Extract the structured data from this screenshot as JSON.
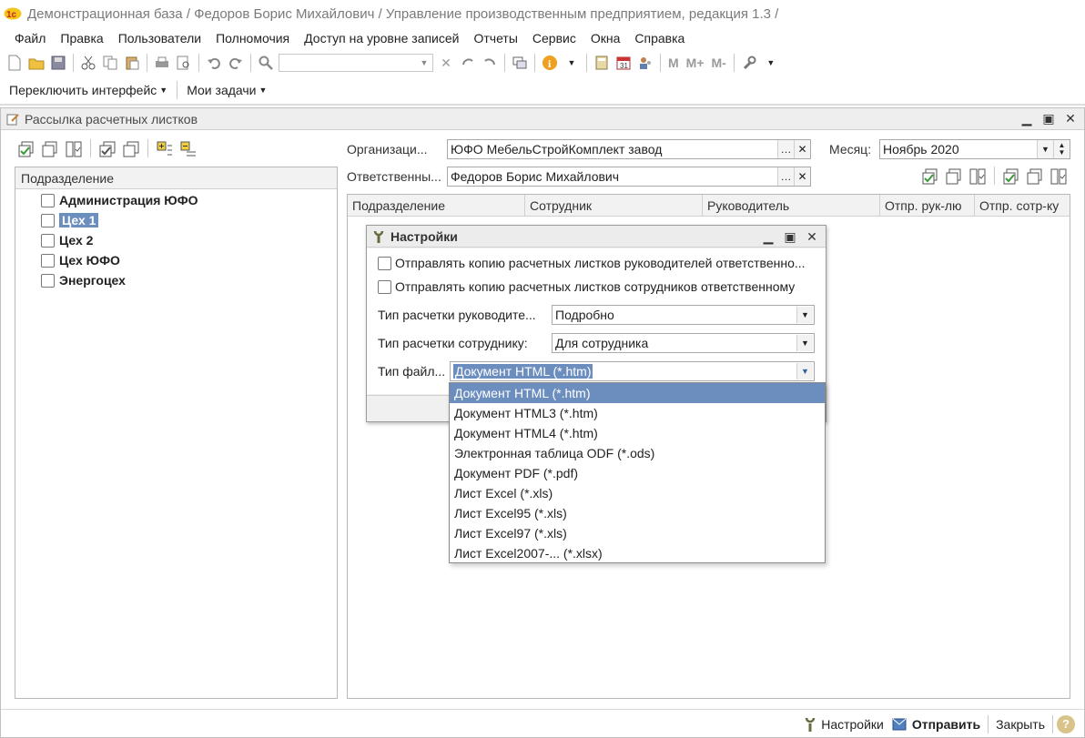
{
  "app": {
    "title": "Демонстрационная база / Федоров Борис Михайлович /  Управление производственным предприятием, редакция 1.3 /"
  },
  "menu": {
    "items": [
      "Файл",
      "Правка",
      "Пользователи",
      "Полномочия",
      "Доступ на уровне записей",
      "Отчеты",
      "Сервис",
      "Окна",
      "Справка"
    ]
  },
  "toolbar": {
    "memory_buttons": [
      "M",
      "M+",
      "M-"
    ]
  },
  "toolbar2": {
    "switch_interface": "Переключить интерфейс",
    "my_tasks": "Мои задачи"
  },
  "window": {
    "title": "Рассылка расчетных листков",
    "tree": {
      "header": "Подразделение",
      "items": [
        {
          "label": "Администрация ЮФО",
          "checked": false,
          "selected": false
        },
        {
          "label": "Цех 1",
          "checked": false,
          "selected": true
        },
        {
          "label": "Цех 2",
          "checked": false,
          "selected": false
        },
        {
          "label": "Цех ЮФО",
          "checked": false,
          "selected": false
        },
        {
          "label": "Энергоцех",
          "checked": false,
          "selected": false
        }
      ]
    },
    "org_label": "Организаци...",
    "org_value": "ЮФО МебельСтройКомплект завод",
    "resp_label": "Ответственны...",
    "resp_value": "Федоров Борис Михайлович",
    "month_label": "Месяц:",
    "month_value": "Ноябрь 2020",
    "grid_columns": [
      "Подразделение",
      "Сотрудник",
      "Руководитель",
      "Отпр. рук-лю",
      "Отпр. сотр-ку"
    ],
    "statusbar": {
      "settings": "Настройки",
      "send": "Отправить",
      "close": "Закрыть"
    }
  },
  "dialog": {
    "title": "Настройки",
    "check1": "Отправлять копию расчетных листков руководителей ответственно...",
    "check2": "Отправлять копию расчетных листков сотрудников ответственному",
    "type_manager_label": "Тип расчетки руководите...",
    "type_manager_value": "Подробно",
    "type_employee_label": "Тип расчетки сотруднику:",
    "type_employee_value": "Для сотрудника",
    "file_type_label": "Тип файл...",
    "file_type_value": "Документ HTML (*.htm)"
  },
  "dropdown": {
    "options": [
      "Документ HTML (*.htm)",
      "Документ HTML3 (*.htm)",
      "Документ HTML4 (*.htm)",
      "Электронная таблица ODF (*.ods)",
      "Документ PDF (*.pdf)",
      "Лист Excel (*.xls)",
      "Лист Excel95 (*.xls)",
      "Лист Excel97 (*.xls)",
      "Лист Excel2007-... (*.xlsx)"
    ],
    "active_index": 0
  },
  "colors": {
    "selection": "#6c8ebf",
    "accent_green": "#3a9a3a"
  }
}
